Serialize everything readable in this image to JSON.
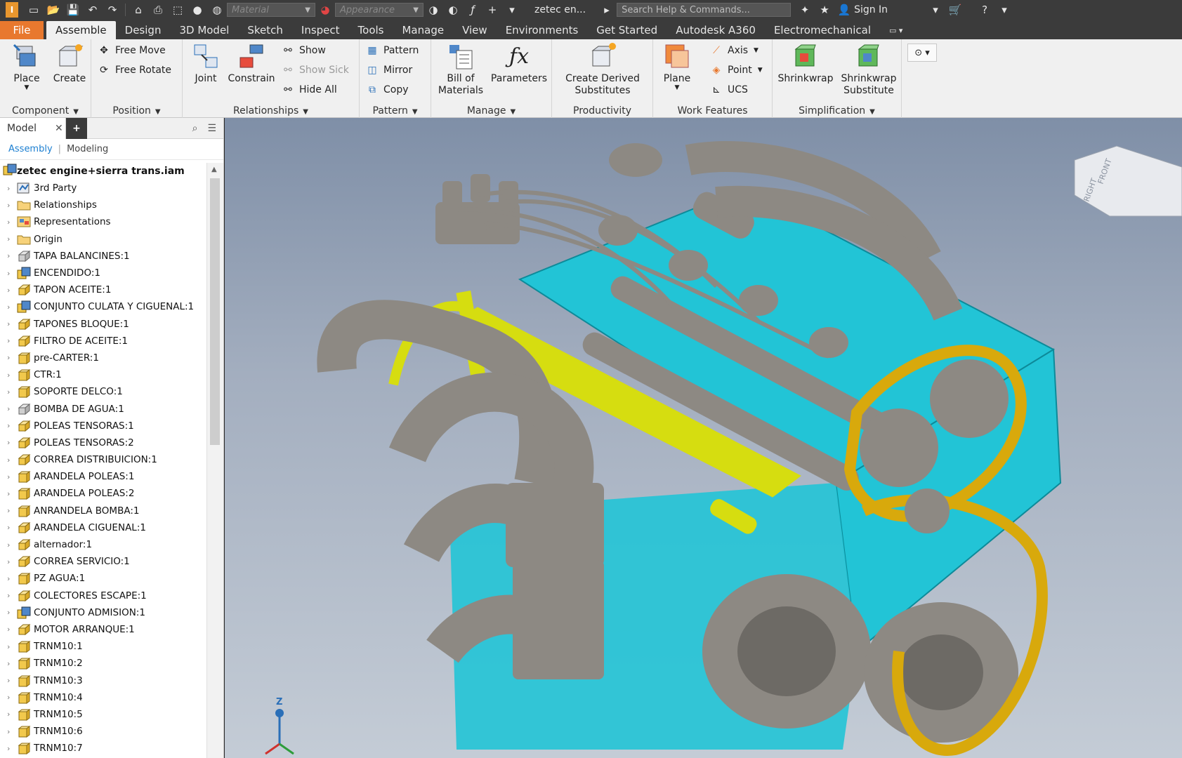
{
  "quick_access": {
    "material_placeholder": "Material",
    "appearance_placeholder": "Appearance",
    "document_title": "zetec en...",
    "search_placeholder": "Search Help & Commands...",
    "sign_in": "Sign In"
  },
  "tabs": [
    "File",
    "Assemble",
    "Design",
    "3D Model",
    "Sketch",
    "Inspect",
    "Tools",
    "Manage",
    "View",
    "Environments",
    "Get Started",
    "Autodesk A360",
    "Electromechanical"
  ],
  "active_tab": "Assemble",
  "ribbon": {
    "component": {
      "title": "Component",
      "place": "Place",
      "create": "Create"
    },
    "position": {
      "title": "Position",
      "free_move": "Free Move",
      "free_rotate": "Free Rotate"
    },
    "relationships": {
      "title": "Relationships",
      "joint": "Joint",
      "constrain": "Constrain",
      "show": "Show",
      "show_sick": "Show Sick",
      "hide_all": "Hide All"
    },
    "pattern": {
      "title": "Pattern",
      "pattern": "Pattern",
      "mirror": "Mirror",
      "copy": "Copy"
    },
    "manage": {
      "title": "Manage",
      "bom_line1": "Bill of",
      "bom_line2": "Materials",
      "parameters": "Parameters"
    },
    "productivity": {
      "title": "Productivity",
      "derived_line1": "Create Derived",
      "derived_line2": "Substitutes"
    },
    "work_features": {
      "title": "Work Features",
      "plane": "Plane",
      "axis": "Axis",
      "point": "Point",
      "ucs": "UCS"
    },
    "simplification": {
      "title": "Simplification",
      "shrinkwrap": "Shrinkwrap",
      "shrinkwrap_sub_line1": "Shrinkwrap",
      "shrinkwrap_sub_line2": "Substitute"
    }
  },
  "browser": {
    "tab_label": "Model",
    "assembly_tab": "Assembly",
    "modeling_tab": "Modeling",
    "root": "zetec engine+sierra trans.iam",
    "items": [
      {
        "label": "3rd Party",
        "icon": "third-party"
      },
      {
        "label": "Relationships",
        "icon": "folder"
      },
      {
        "label": "Representations",
        "icon": "representations"
      },
      {
        "label": "Origin",
        "icon": "folder"
      },
      {
        "label": "TAPA BALANCINES:1",
        "icon": "part-gray"
      },
      {
        "label": "ENCENDIDO:1",
        "icon": "assembly"
      },
      {
        "label": "TAPON ACEITE:1",
        "icon": "part"
      },
      {
        "label": "CONJUNTO CULATA Y CIGUENAL:1",
        "icon": "assembly"
      },
      {
        "label": "TAPONES BLOQUE:1",
        "icon": "part"
      },
      {
        "label": "FILTRO DE ACEITE:1",
        "icon": "part"
      },
      {
        "label": "pre-CARTER:1",
        "icon": "part-box"
      },
      {
        "label": "CTR:1",
        "icon": "part-box"
      },
      {
        "label": "SOPORTE DELCO:1",
        "icon": "part-box"
      },
      {
        "label": "BOMBA DE AGUA:1",
        "icon": "part-gray"
      },
      {
        "label": "POLEAS TENSORAS:1",
        "icon": "part"
      },
      {
        "label": "POLEAS TENSORAS:2",
        "icon": "part"
      },
      {
        "label": "CORREA DISTRIBUICION:1",
        "icon": "part"
      },
      {
        "label": "ARANDELA POLEAS:1",
        "icon": "part-box"
      },
      {
        "label": "ARANDELA POLEAS:2",
        "icon": "part-box"
      },
      {
        "label": "ANRANDELA BOMBA:1",
        "icon": "part-box"
      },
      {
        "label": "ARANDELA CIGUENAL:1",
        "icon": "part"
      },
      {
        "label": "alternador:1",
        "icon": "part"
      },
      {
        "label": "CORREA SERVICIO:1",
        "icon": "part"
      },
      {
        "label": "PZ AGUA:1",
        "icon": "part-box"
      },
      {
        "label": "COLECTORES ESCAPE:1",
        "icon": "part"
      },
      {
        "label": "CONJUNTO ADMISION:1",
        "icon": "assembly"
      },
      {
        "label": "MOTOR ARRANQUE:1",
        "icon": "part"
      },
      {
        "label": "TRNM10:1",
        "icon": "part-box"
      },
      {
        "label": "TRNM10:2",
        "icon": "part-box"
      },
      {
        "label": "TRNM10:3",
        "icon": "part-box"
      },
      {
        "label": "TRNM10:4",
        "icon": "part-box"
      },
      {
        "label": "TRNM10:5",
        "icon": "part-box"
      },
      {
        "label": "TRNM10:6",
        "icon": "part-box"
      },
      {
        "label": "TRNM10:7",
        "icon": "part-box"
      }
    ]
  },
  "viewcube": {
    "face_front": "FRONT",
    "face_right": "RIGHT"
  },
  "triad": {
    "z_label": "Z"
  },
  "colors": {
    "block": "#22c4d6",
    "metal": "#8d8983",
    "intake": "#d6dd10",
    "belt": "#d8a90c",
    "file_tab": "#e8782e"
  }
}
